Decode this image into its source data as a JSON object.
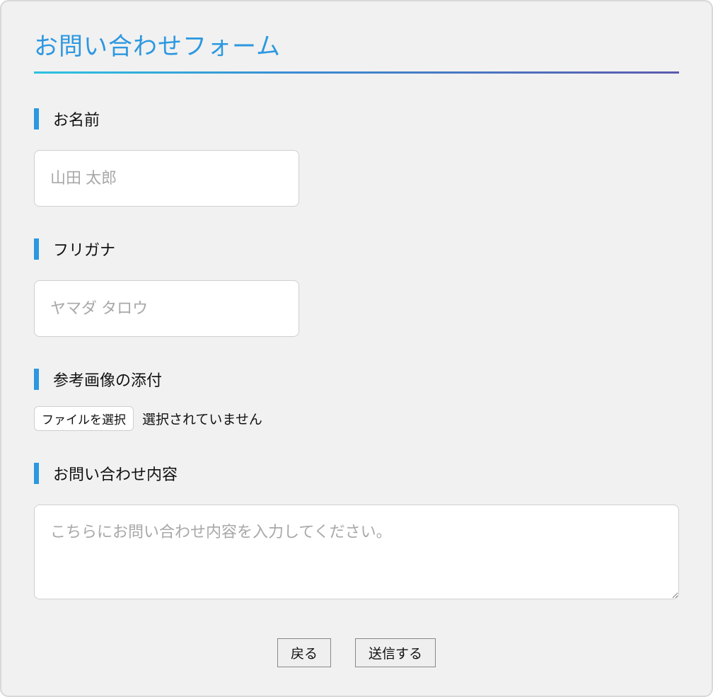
{
  "form": {
    "title": "お問い合わせフォーム",
    "fields": {
      "name": {
        "label": "お名前",
        "placeholder": "山田 太郎",
        "value": ""
      },
      "furigana": {
        "label": "フリガナ",
        "placeholder": "ヤマダ タロウ",
        "value": ""
      },
      "attachment": {
        "label": "参考画像の添付",
        "button_label": "ファイルを選択",
        "status_text": "選択されていません"
      },
      "inquiry": {
        "label": "お問い合わせ内容",
        "placeholder": "こちらにお問い合わせ内容を入力してください。",
        "value": ""
      }
    },
    "buttons": {
      "back": "戻る",
      "submit": "送信する"
    }
  }
}
